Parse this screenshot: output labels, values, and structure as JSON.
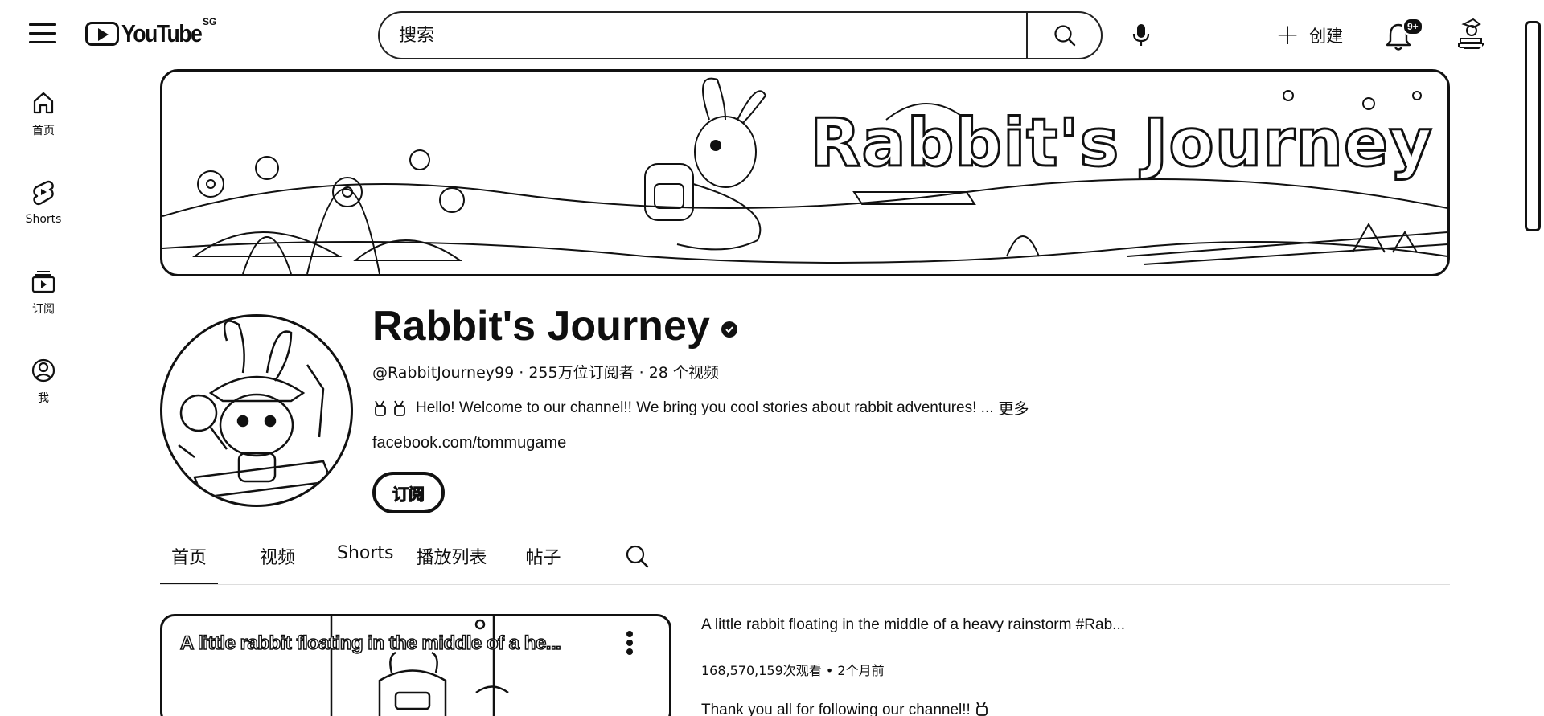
{
  "header": {
    "logo_text": "YouTube",
    "region": "SG",
    "search_placeholder": "搜索",
    "create_label": "创建",
    "notification_count": "9+"
  },
  "sidebar": {
    "items": [
      {
        "label": "首页",
        "icon": "home-icon"
      },
      {
        "label": "Shorts",
        "icon": "shorts-icon"
      },
      {
        "label": "订阅",
        "icon": "subscriptions-icon"
      },
      {
        "label": "我",
        "icon": "profile-icon"
      }
    ]
  },
  "banner": {
    "title": "Rabbit's Journey"
  },
  "channel": {
    "name": "Rabbit's Journey",
    "handle": "@RabbitJourney99",
    "subscribers": "255万位订阅者",
    "videos": "28 个视频",
    "meta_separator": " · ",
    "description": "Hello! Welcome to our channel!! We bring you cool stories about rabbit adventures! ...",
    "more_label": "更多",
    "link": "facebook.com/tommugame",
    "subscribe_label": "订阅"
  },
  "tabs": [
    {
      "label": "首页",
      "active": true
    },
    {
      "label": "视频",
      "active": false
    },
    {
      "label": "Shorts",
      "active": false
    },
    {
      "label": "播放列表",
      "active": false
    },
    {
      "label": "帖子",
      "active": false
    }
  ],
  "featured": {
    "thumb_title": "A little rabbit floating in the middle of a he...",
    "title": "A little rabbit floating in the middle of a heavy rainstorm #Rab...",
    "views": "168,570,159次观看",
    "age": "2个月前",
    "meta_separator": " • ",
    "description": "Thank you all for following our channel!!"
  },
  "colors": {
    "text": "#0f0f0f",
    "background": "#ffffff"
  }
}
